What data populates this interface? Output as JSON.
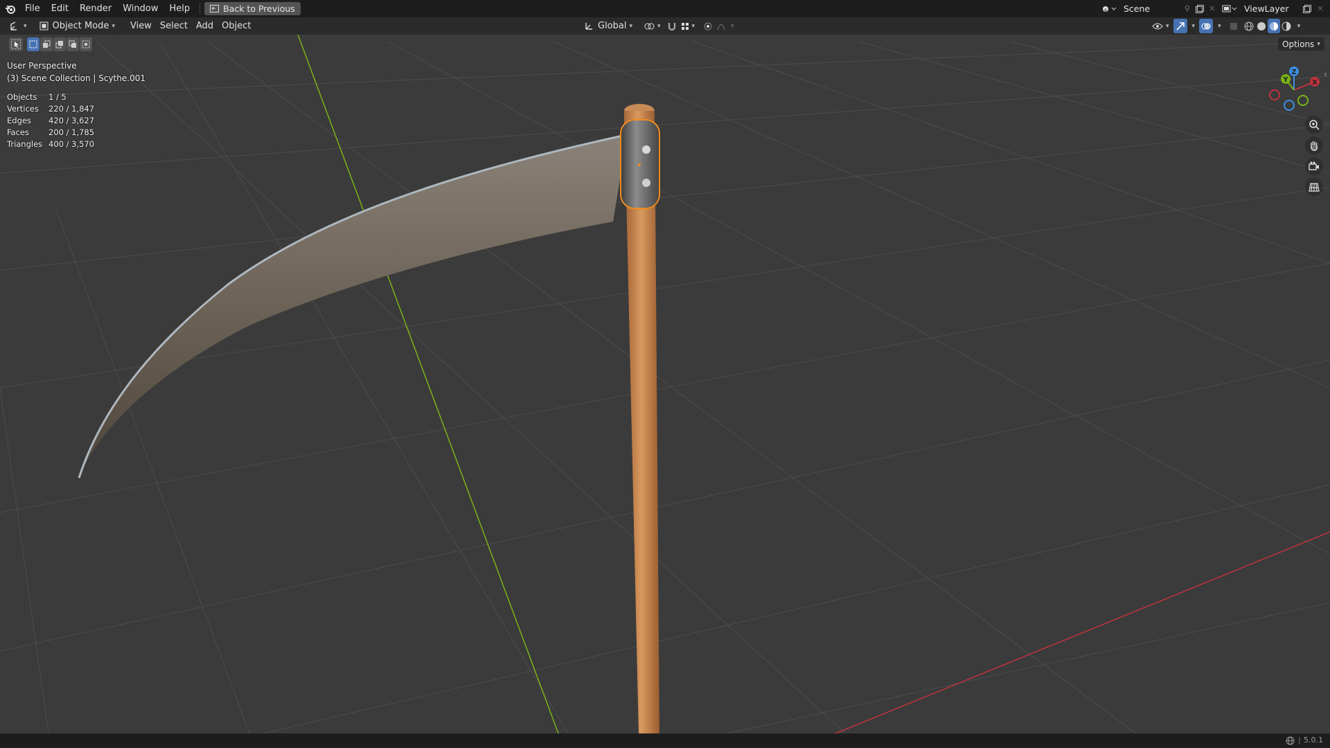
{
  "topbar": {
    "menus": [
      "File",
      "Edit",
      "Render",
      "Window",
      "Help"
    ],
    "back_button": "Back to Previous",
    "scene_name": "Scene",
    "view_layer": "ViewLayer"
  },
  "header": {
    "mode": "Object Mode",
    "menus": [
      "View",
      "Select",
      "Add",
      "Object"
    ],
    "transform_orientation": "Global",
    "options_label": "Options"
  },
  "viewport": {
    "perspective": "User Perspective",
    "collection": "(3) Scene Collection | Scythe.001",
    "stats": [
      {
        "label": "Objects",
        "value": "1 / 5"
      },
      {
        "label": "Vertices",
        "value": "220 / 1,847"
      },
      {
        "label": "Edges",
        "value": "420 / 3,627"
      },
      {
        "label": "Faces",
        "value": "200 / 1,785"
      },
      {
        "label": "Triangles",
        "value": "400 / 3,570"
      }
    ],
    "gizmo": {
      "x": "X",
      "y": "Y",
      "z": "Z"
    }
  },
  "statusbar": {
    "version": "5.0.1"
  },
  "colors": {
    "accent": "#4772b3",
    "selection": "#f28c1c",
    "x_axis": "#c2323c",
    "y_axis": "#7ab319",
    "z_axis": "#3b8fe0"
  }
}
